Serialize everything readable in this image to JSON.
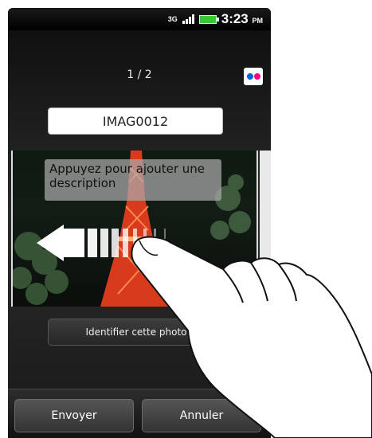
{
  "status": {
    "network": "3G",
    "time": "3:23",
    "ampm": "PM"
  },
  "viewer": {
    "counter": "1 / 2",
    "service_icon": "flickr-icon"
  },
  "photo": {
    "name": "IMAG0012",
    "description_placeholder": "Appuyez pour ajouter une description"
  },
  "actions": {
    "identify_label": "Identifier cette photo",
    "send_label": "Envoyer",
    "cancel_label": "Annuler"
  },
  "colors": {
    "flickr_blue": "#0063dc",
    "flickr_pink": "#ff0084",
    "battery_green": "#33cc33"
  }
}
